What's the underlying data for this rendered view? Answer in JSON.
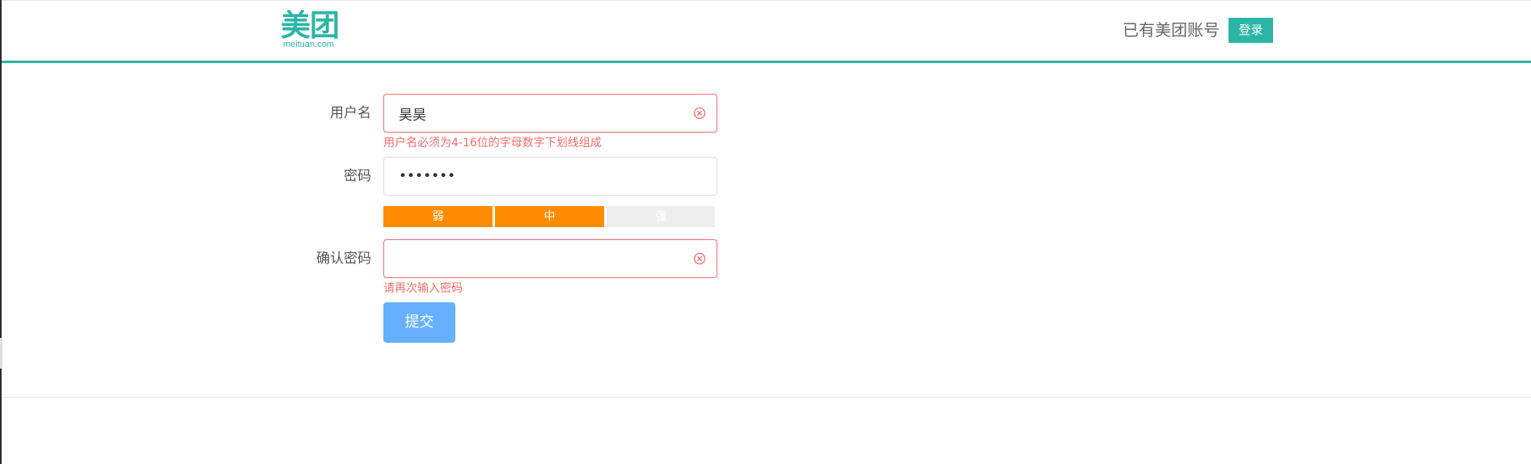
{
  "header": {
    "logo_cn": "美团",
    "logo_en": "meituan.com",
    "account_prompt": "已有美团账号",
    "login_label": "登录",
    "accent_color": "#2bb5a6"
  },
  "form": {
    "username": {
      "label": "用户名",
      "value": "昊昊",
      "error": "用户名必须为4-16位的字母数字下划线组成",
      "icon": "circle-x-icon"
    },
    "password": {
      "label": "密码",
      "value": "•••••••"
    },
    "strength": {
      "levels": [
        "弱",
        "中",
        "强"
      ],
      "active_count": 2,
      "active_color": "#ff8c00"
    },
    "confirm": {
      "label": "确认密码",
      "value": "",
      "error": "请再次输入密码",
      "icon": "circle-x-icon"
    },
    "submit_label": "提交",
    "error_color": "#f56c6c"
  }
}
